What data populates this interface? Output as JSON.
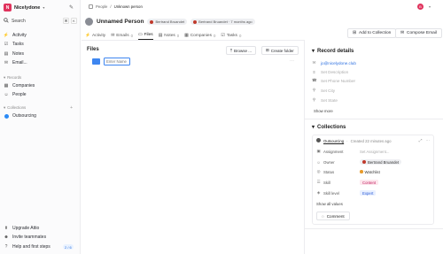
{
  "workspace": {
    "name": "Nicelydone",
    "logo_letter": "N"
  },
  "search": {
    "label": "Search",
    "kbd1": "⌘",
    "kbd2": "K"
  },
  "nav": [
    {
      "label": "Activity",
      "icon": "activity-icon"
    },
    {
      "label": "Tasks",
      "icon": "tasks-icon"
    },
    {
      "label": "Notes",
      "icon": "notes-icon"
    },
    {
      "label": "Email...",
      "icon": "email-icon"
    }
  ],
  "records_section": {
    "title": "Records",
    "items": [
      {
        "label": "Companies"
      },
      {
        "label": "People"
      }
    ]
  },
  "collections_section": {
    "title": "Collections",
    "items": [
      {
        "label": "Outsourcing"
      }
    ]
  },
  "bottom_nav": [
    {
      "label": "Upgrade Attio"
    },
    {
      "label": "Invite teammates"
    },
    {
      "label": "Help and first steps",
      "badge": "2 / 6"
    }
  ],
  "breadcrumb": {
    "root": "People",
    "current": "Unknown person"
  },
  "user": {
    "initial": "B"
  },
  "record": {
    "title": "Unnamed Person",
    "owner_chip": "Bertrand Bruandet",
    "updated_chip": "Bertrand Bruandet · 7 months ago"
  },
  "actions": {
    "add_to_collection": "Add to Collection",
    "compose_email": "Compose Email"
  },
  "tabs": [
    {
      "label": "Activity",
      "count": ""
    },
    {
      "label": "Emails",
      "count": "0"
    },
    {
      "label": "Files",
      "count": ""
    },
    {
      "label": "Notes",
      "count": "0"
    },
    {
      "label": "Companies",
      "count": "0"
    },
    {
      "label": "Tasks",
      "count": "0"
    }
  ],
  "files": {
    "title": "Files",
    "browse": "Browse ...",
    "create_folder": "Create folder",
    "new_folder_placeholder": "Enter Name"
  },
  "record_details": {
    "title": "Record details",
    "fields": [
      {
        "icon": "email-icon",
        "value": "jo@nicelydone.club",
        "is_link": true
      },
      {
        "icon": "description-icon",
        "value": "Set Description",
        "is_link": false
      },
      {
        "icon": "phone-icon",
        "value": "Set Phone Number",
        "is_link": false
      },
      {
        "icon": "location-icon",
        "value": "Set City",
        "is_link": false
      },
      {
        "icon": "location-icon",
        "value": "Set State",
        "is_link": false
      }
    ],
    "show_more": "Show more"
  },
  "collections": {
    "title": "Collections",
    "card": {
      "name": "Outsourcing",
      "created": "Created 22 minutes ago",
      "attributes": [
        {
          "label": "Assignment",
          "value": "Set Assignment..."
        },
        {
          "label": "Owner",
          "value": "Bertrand Bruandet"
        },
        {
          "label": "Status",
          "value": "Watchlist"
        },
        {
          "label": "Skill",
          "value": "Content"
        },
        {
          "label": "Skill level",
          "value": "Expert"
        }
      ],
      "show_all": "Show all values",
      "comment": "Comment"
    }
  },
  "colors": {
    "brand": "#e0335d",
    "accent": "#3e86f0",
    "status": "#e89b2b"
  }
}
